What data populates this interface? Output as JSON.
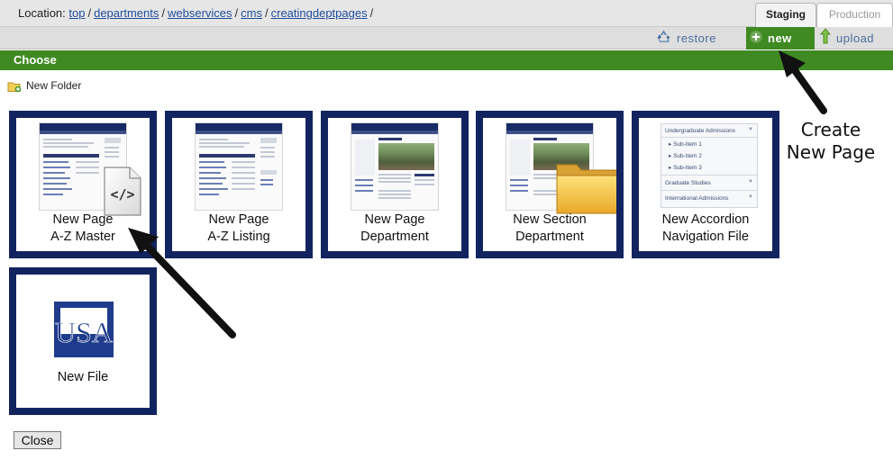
{
  "location": {
    "label": "Location:",
    "crumbs": [
      "top",
      "departments",
      "webservices",
      "cms",
      "creatingdeptpages"
    ],
    "trailing_sep": "/"
  },
  "tabs": {
    "staging": "Staging",
    "production": "Production"
  },
  "actions": {
    "restore": "restore",
    "new": "new",
    "upload": "upload"
  },
  "choose": {
    "title": "Choose"
  },
  "new_folder": {
    "label": "New Folder"
  },
  "templates": [
    {
      "line1": "New Page",
      "line2": "A-Z Master"
    },
    {
      "line1": "New Page",
      "line2": "A-Z Listing"
    },
    {
      "line1": "New Page",
      "line2": "Department"
    },
    {
      "line1": "New Section",
      "line2": "Department"
    },
    {
      "line1": "New Accordion",
      "line2": "Navigation File"
    },
    {
      "line1": "New File",
      "line2": ""
    }
  ],
  "accordion_preview": {
    "header": "Undergraduate Admissions",
    "items": [
      "Sub-Item 1",
      "Sub-Item 2",
      "Sub-Item 3"
    ],
    "sections": [
      "Graduate Studies",
      "International Admissions"
    ]
  },
  "code_badge": "</>",
  "logo_text": "USA",
  "close_button": "Close",
  "annotation": {
    "line1": "Create",
    "line2": "New Page"
  },
  "colors": {
    "green": "#3f8a22",
    "navy": "#122460",
    "link": "#1f4e9c"
  }
}
